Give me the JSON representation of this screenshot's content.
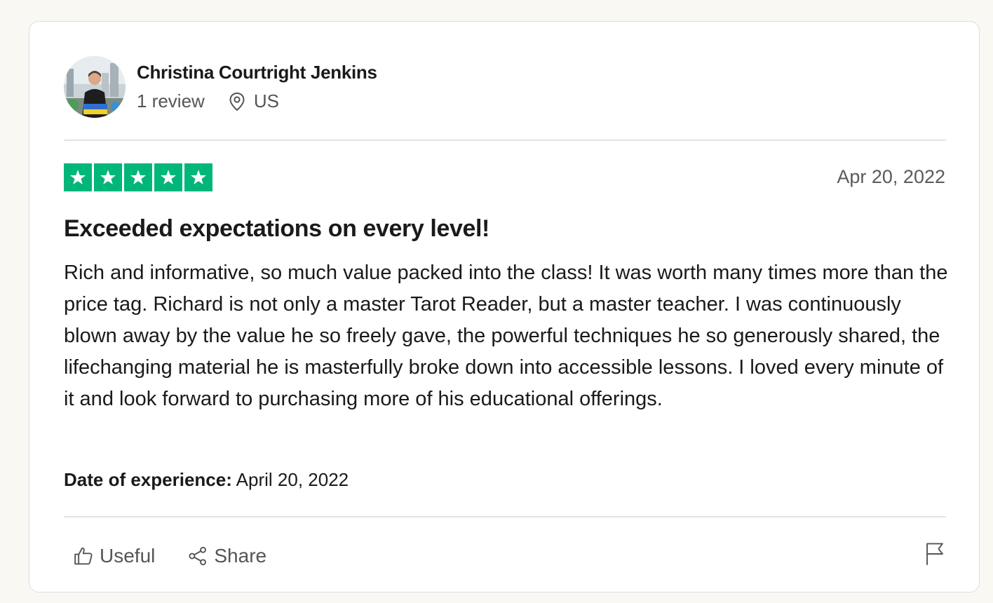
{
  "reviewer": {
    "name": "Christina Courtright Jenkins",
    "review_count": "1 review",
    "country": "US"
  },
  "review": {
    "rating": 5,
    "rating_max": 5,
    "star_color": "#00b67a",
    "date": "Apr 20, 2022",
    "title": "Exceeded expectations on every level!",
    "body": "Rich and informative, so much value packed into the class! It was worth many times more than the price tag. Richard is not only a master Tarot Reader, but a master teacher. I was continuously blown away by the value he so freely gave, the powerful techniques he so generously shared, the lifechanging material he is masterfully broke down into accessible lessons. I loved every minute of it and look forward to purchasing more of his educational offerings.",
    "experience_label": "Date of experience:",
    "experience_date": "April 20, 2022"
  },
  "actions": {
    "useful_label": "Useful",
    "share_label": "Share"
  },
  "icons": {
    "location": "location-pin-icon",
    "useful": "thumbs-up-icon",
    "share": "share-icon",
    "report": "flag-icon",
    "rating": "star-icon"
  }
}
